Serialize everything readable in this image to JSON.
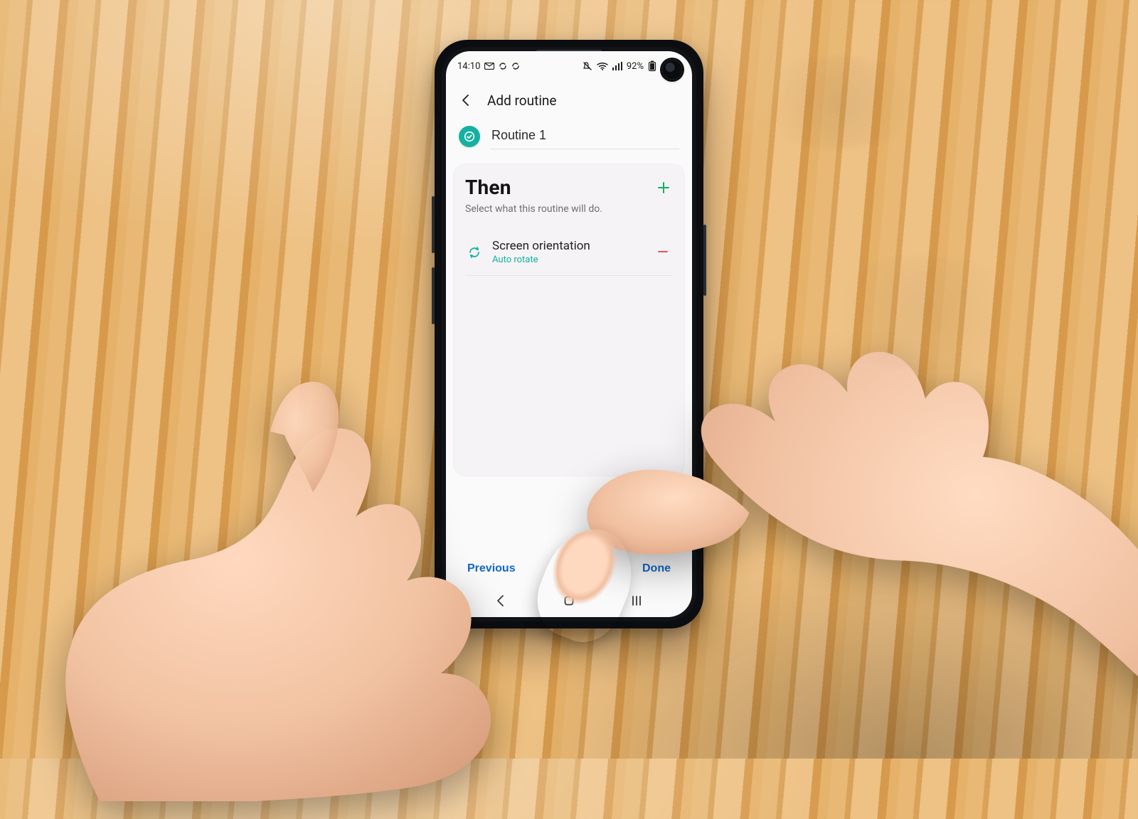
{
  "statusbar": {
    "time": "14:10",
    "battery_text": "92%",
    "icons": [
      "mail-icon",
      "sync-icon",
      "sync-icon",
      "mute-icon",
      "wifi-icon",
      "signal-icon",
      "battery-icon"
    ]
  },
  "appbar": {
    "title": "Add routine"
  },
  "routine": {
    "name": "Routine 1",
    "icon_name": "check-icon"
  },
  "section": {
    "title": "Then",
    "subtitle": "Select what this routine will do."
  },
  "actions": [
    {
      "title": "Screen orientation",
      "value": "Auto rotate",
      "icon_name": "rotate-icon"
    }
  ],
  "footer": {
    "prev": "Previous",
    "done": "Done"
  },
  "colors": {
    "accent": "#14b1a1",
    "add": "#17b05b",
    "remove": "#e25653",
    "link": "#1168c4"
  }
}
